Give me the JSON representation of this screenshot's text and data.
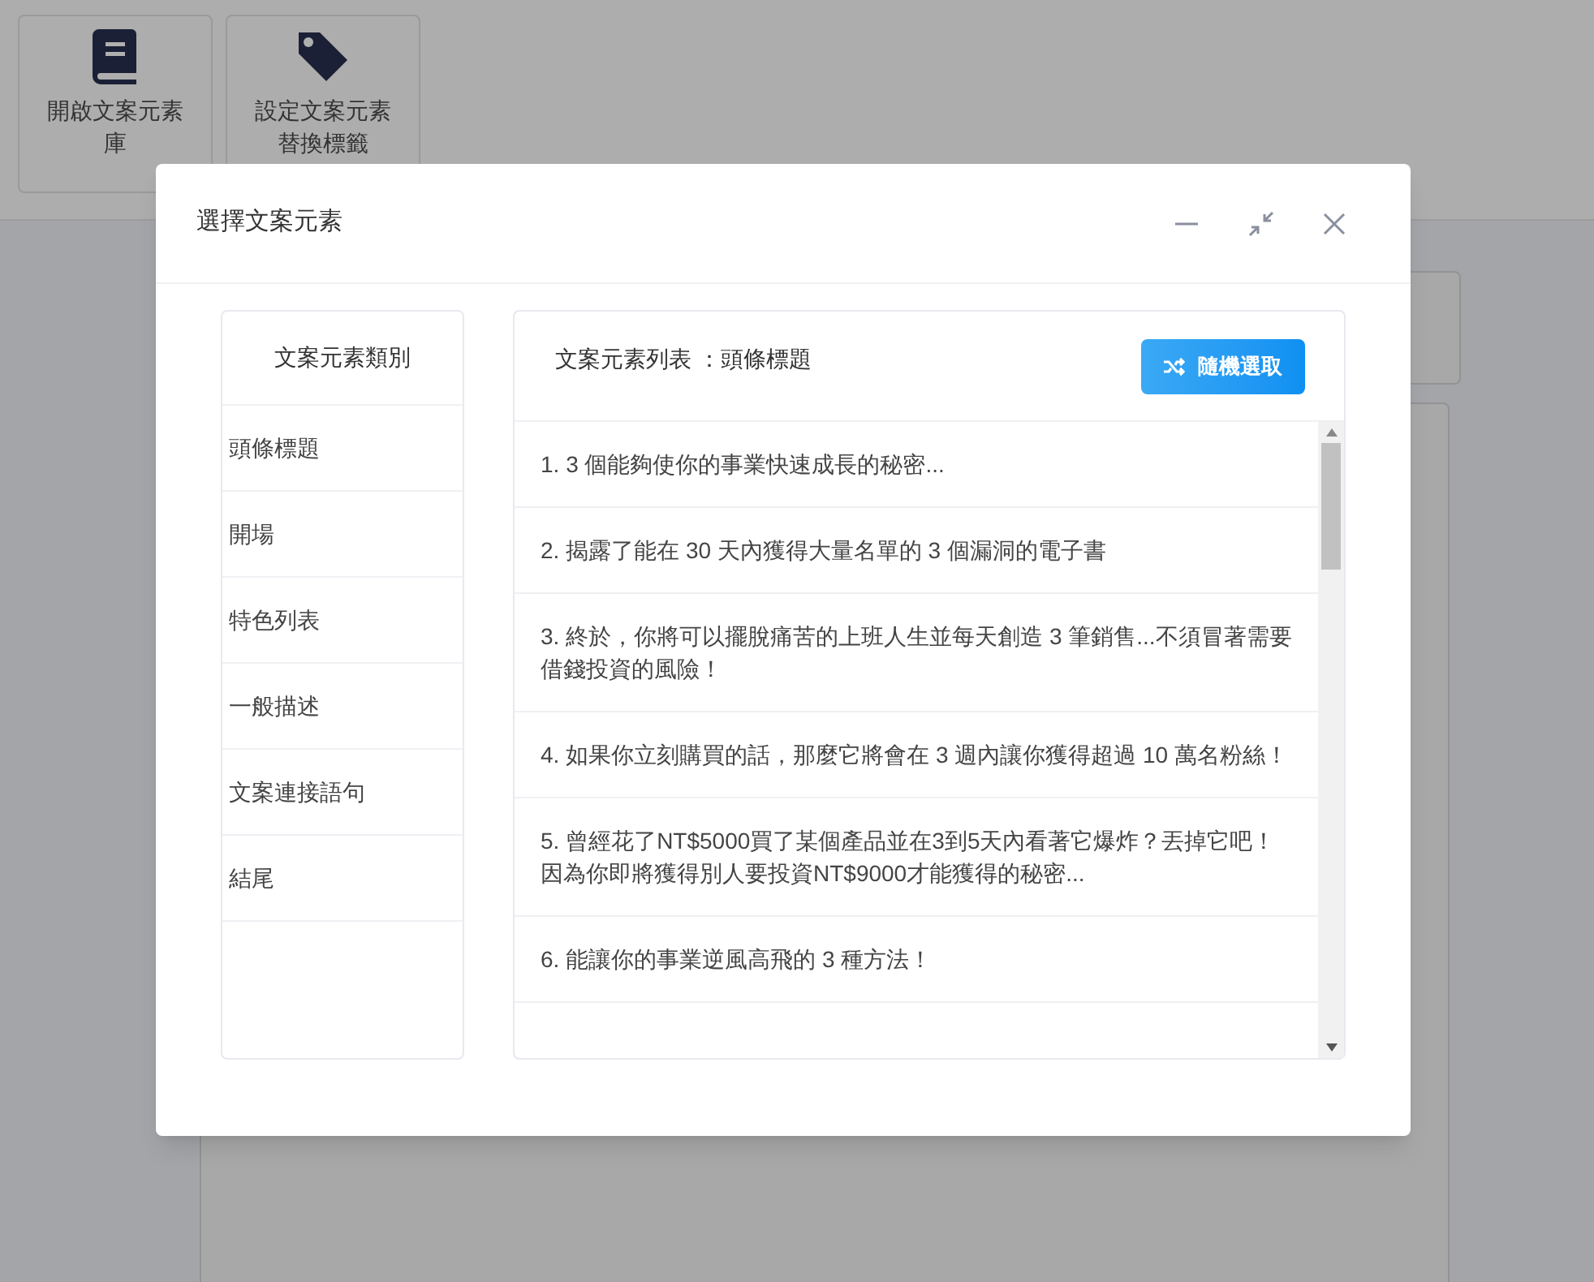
{
  "toolbar": {
    "buttons": [
      {
        "kind": "book",
        "lines": [
          "開啟文案元素",
          "庫"
        ]
      },
      {
        "kind": "tag",
        "lines": [
          "設定文案元素",
          "替換標籤"
        ]
      }
    ]
  },
  "dialog": {
    "title": "選擇文案元素",
    "categories": {
      "heading": "文案元素類別",
      "items": [
        "頭條標題",
        "開場",
        "特色列表",
        "一般描述",
        "文案連接語句",
        "結尾"
      ]
    },
    "list": {
      "heading": "文案元素列表 ：頭條標題",
      "random_button": "隨機選取",
      "items": [
        "1. 3 個能夠使你的事業快速成長的秘密...",
        "2. 揭露了能在 30 天內獲得大量名單的 3 個漏洞的電子書",
        "3. 終於，你將可以擺脫痛苦的上班人生並每天創造 3 筆銷售...不須冒著需要借錢投資的風險！",
        "4. 如果你立刻購買的話，那麼它將會在 3 週內讓你獲得超過 10 萬名粉絲！",
        "5. 曾經花了NT$5000買了某個產品並在3到5天內看著它爆炸？丟掉它吧！因為你即將獲得別人要投資NT$9000才能獲得的秘密...",
        "6. 能讓你的事業逆風高飛的 3 種方法！"
      ]
    }
  }
}
